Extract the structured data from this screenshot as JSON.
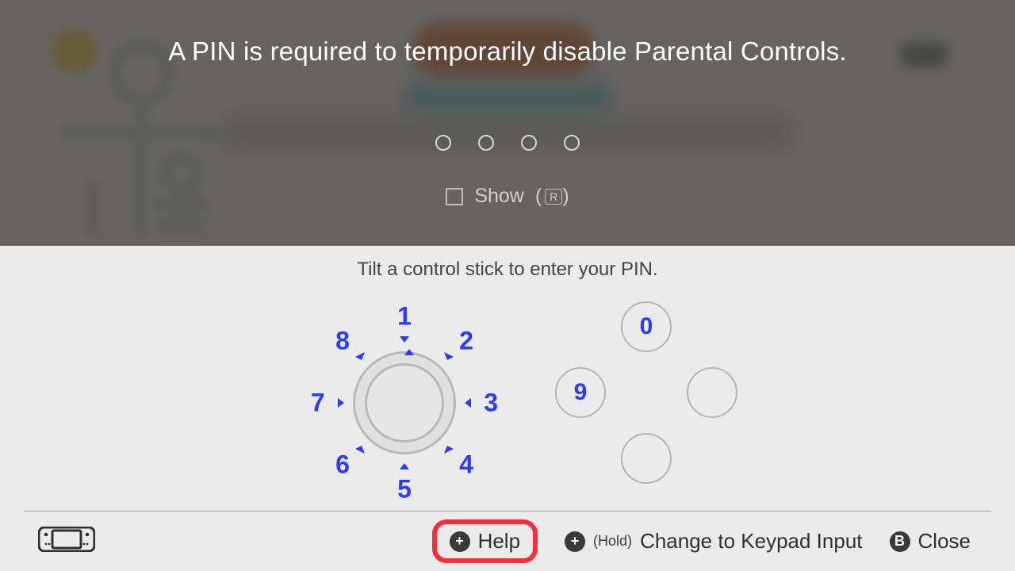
{
  "header": {
    "title": "A PIN is required to temporarily disable Parental Controls."
  },
  "pin": {
    "length": 4,
    "show_label": "Show",
    "show_hint_button": "R"
  },
  "instruction": "Tilt a control stick to enter your PIN.",
  "dial": {
    "n1": "1",
    "n2": "2",
    "n3": "3",
    "n4": "4",
    "n5": "5",
    "n6": "6",
    "n7": "7",
    "n8": "8"
  },
  "face": {
    "top": "0",
    "left": "9",
    "right": "",
    "bottom": ""
  },
  "footer": {
    "help_glyph": "+",
    "help_label": "Help",
    "change_glyph": "+",
    "change_hold": "(Hold)",
    "change_label": "Change to Keypad Input",
    "close_glyph": "B",
    "close_label": "Close"
  }
}
